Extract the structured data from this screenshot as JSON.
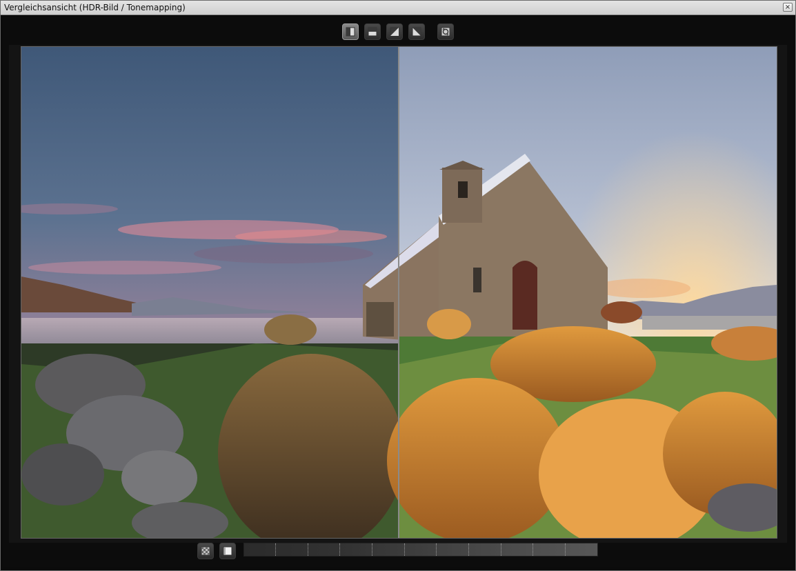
{
  "window": {
    "title": "Vergleichsansicht (HDR-Bild / Tonemapping)",
    "close_glyph": "×"
  },
  "toolbar": {
    "buttons": [
      {
        "name": "split-vertical-icon",
        "active": true
      },
      {
        "name": "split-horizontal-icon",
        "active": false
      },
      {
        "name": "split-diagonal-left-icon",
        "active": false
      },
      {
        "name": "split-diagonal-right-icon",
        "active": false
      },
      {
        "name": "swap-view-icon",
        "active": false
      }
    ]
  },
  "bottombar": {
    "buttons": [
      {
        "name": "checker-background-icon"
      },
      {
        "name": "white-background-icon"
      }
    ]
  },
  "colors": {
    "accent_active": "#7a7a7a",
    "panel": "#0c0c0c",
    "divider": "#8a8a8a"
  }
}
